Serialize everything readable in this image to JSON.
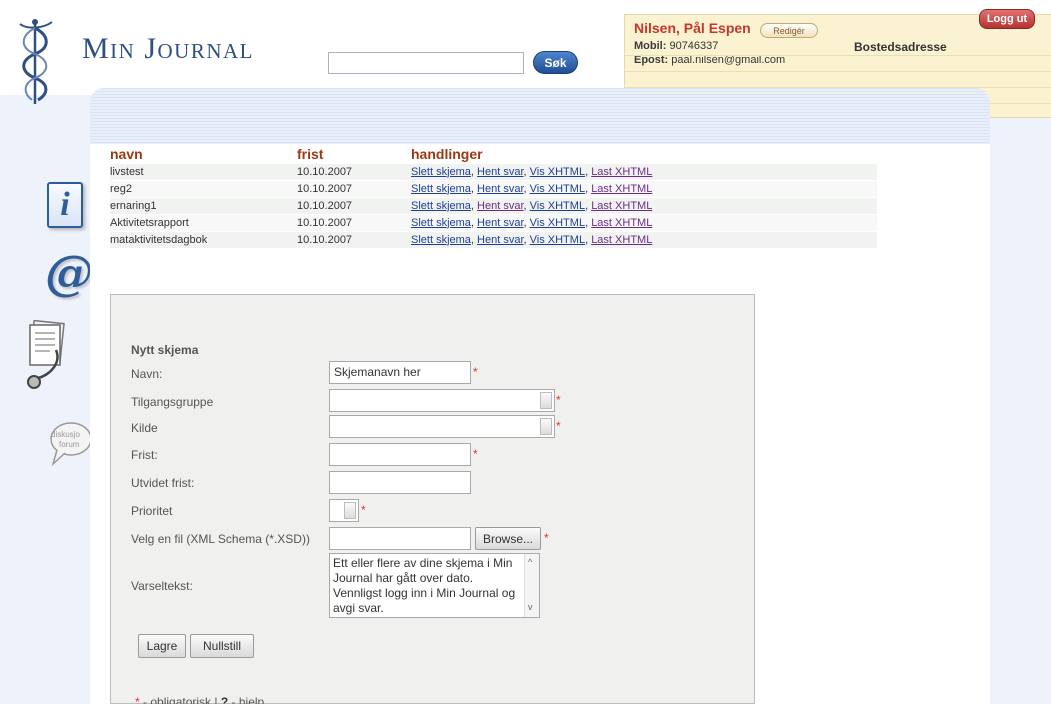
{
  "app": {
    "title": "Min Journal"
  },
  "search": {
    "placeholder": "",
    "button_label": "Søk"
  },
  "user": {
    "name": "Nilsen, Pål Espen",
    "edit_label": "Redigér",
    "mobile_label": "Mobil:",
    "mobile_value": "90746337",
    "email_label": "Epost:",
    "email_value": "paal.nilsen@gmail.com",
    "address_label": "Bostedsadresse",
    "logout_label": "Logg ut"
  },
  "nav": {
    "info_glyph": "i",
    "at_glyph": "@",
    "forum_label_1": "diskusjo",
    "forum_label_2": "forum",
    "icons": [
      "info-icon",
      "email-at-icon",
      "journal-stethoscope-icon",
      "discussion-forum-icon"
    ]
  },
  "forms_table": {
    "headers": [
      "navn",
      "frist",
      "handlinger"
    ],
    "actions": [
      "Slett skjema",
      "Hent svar",
      "Vis XHTML",
      "Last XHTML"
    ],
    "rows": [
      {
        "name": "livstest",
        "deadline": "10.10.2007"
      },
      {
        "name": "reg2",
        "deadline": "10.10.2007"
      },
      {
        "name": "ernaring1",
        "deadline": "10.10.2007"
      },
      {
        "name": "Aktivitetsrapport",
        "deadline": "10.10.2007"
      },
      {
        "name": "mataktivitetsdagbok",
        "deadline": "10.10.2007"
      }
    ]
  },
  "new_form": {
    "title": "Nytt skjema",
    "name_label": "Navn:",
    "name_value": "Skjemanavn her",
    "access_label": "Tilgangsgruppe",
    "source_label": "Kilde",
    "deadline_label": "Frist:",
    "extended_label": "Utvidet frist:",
    "priority_label": "Prioritet",
    "file_label": "Velg en fil (XML Schema (*.XSD))",
    "browse_label": "Browse...",
    "notice_label": "Varseltekst:",
    "notice_value": "Ett eller flere av dine skjema i Min Journal har gått over dato. Vennligst logg inn i Min Journal og avgi svar.",
    "save_label": "Lagre",
    "reset_label": "Nullstill",
    "required_mark": "*",
    "legend_required": "- obligatorisk |",
    "legend_help_mark": "?",
    "legend_help": "- hjelp"
  },
  "colors": {
    "brand_blue": "#2f4f84",
    "accent_red": "#c0392b",
    "header_brown": "#9a3a12",
    "link_blue": "#1f3f9a",
    "link_visited": "#6b2b8c"
  }
}
